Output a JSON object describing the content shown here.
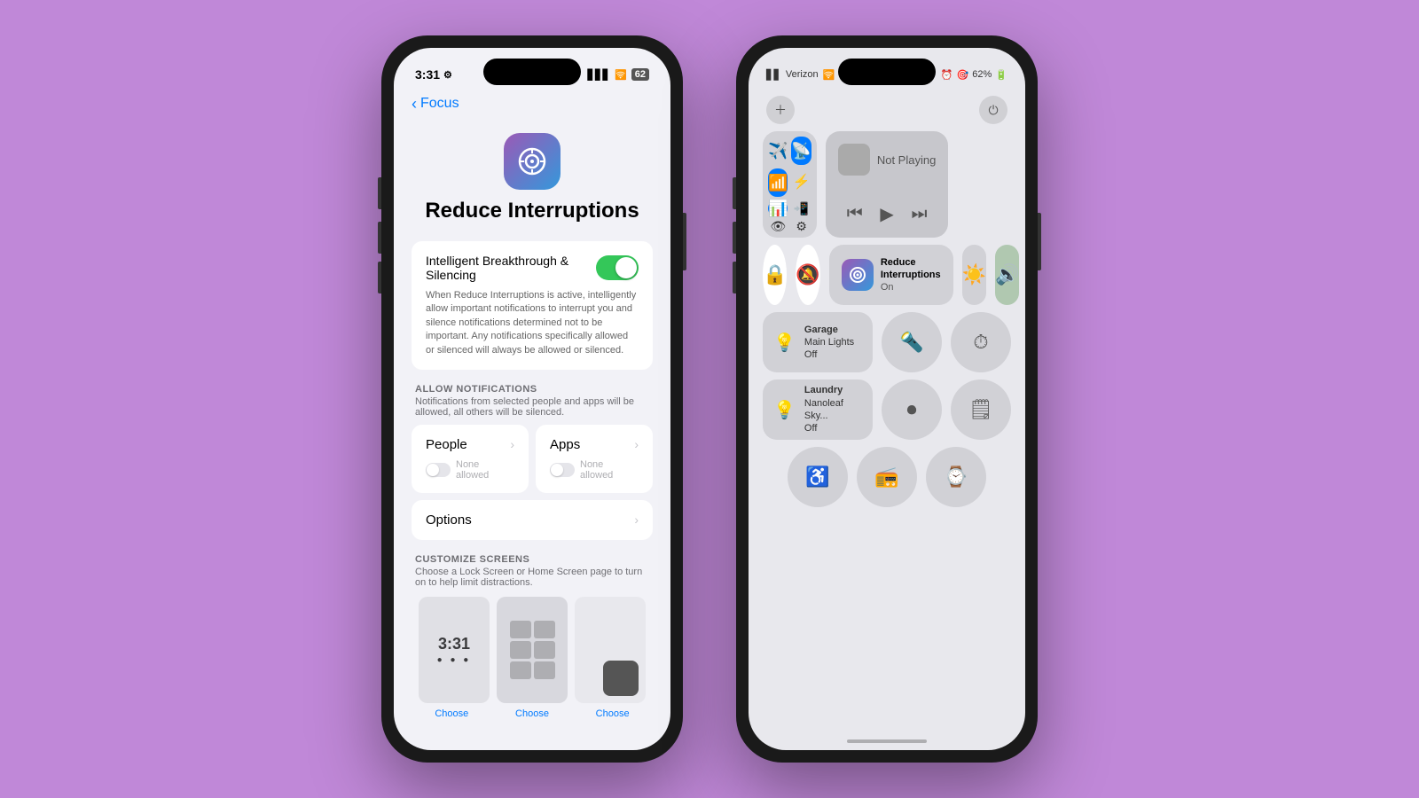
{
  "background_color": "#c088d8",
  "left_phone": {
    "status_bar": {
      "time": "3:31",
      "signal_icon": "📶",
      "wifi_icon": "📡",
      "battery": "62"
    },
    "back_nav": {
      "label": "Focus"
    },
    "focus_icon_emoji": "⚙️",
    "title": "Reduce Interruptions",
    "toggle_section": {
      "label": "Intelligent Breakthrough & Silencing",
      "description": "When Reduce Interruptions is active, intelligently allow important notifications to interrupt you and silence notifications determined not to be important. Any notifications specifically allowed or silenced will always be allowed or silenced."
    },
    "allow_notifications": {
      "header": "ALLOW NOTIFICATIONS",
      "description": "Notifications from selected people and apps will be allowed, all others will be silenced.",
      "people_label": "People",
      "people_sub": "None allowed",
      "apps_label": "Apps",
      "apps_sub": "None allowed"
    },
    "options_label": "Options",
    "customize_screens": {
      "header": "CUSTOMIZE SCREENS",
      "description": "Choose a Lock Screen or Home Screen page to turn on to help limit distractions."
    },
    "choose_label": "Choose"
  },
  "right_phone": {
    "status_bar": {
      "carrier": "Verizon",
      "battery": "62%"
    },
    "connectivity": {
      "airplane_label": "Airplane",
      "hotspot_label": "Hotspot",
      "wifi_label": "WiFi",
      "bluetooth_label": "Bluetooth",
      "cellular_label": "Cellular",
      "airdrop_label": "AirDrop",
      "focus_label": "Focus"
    },
    "media": {
      "title": "Not Playing"
    },
    "controls": {
      "privacy_label": "Privacy",
      "silent_label": "Silent",
      "focus_name": "Reduce Interruptions",
      "focus_status": "On",
      "brightness_label": "Brightness",
      "volume_label": "Volume"
    },
    "lights": [
      {
        "name": "Garage",
        "label": "Main Lights",
        "status": "Off"
      },
      {
        "name": "Laundry",
        "label": "Nanoleaf Sky...",
        "status": "Off"
      }
    ],
    "bottom_row": [
      "Accessibility",
      "Remote",
      "Watch Face"
    ]
  }
}
